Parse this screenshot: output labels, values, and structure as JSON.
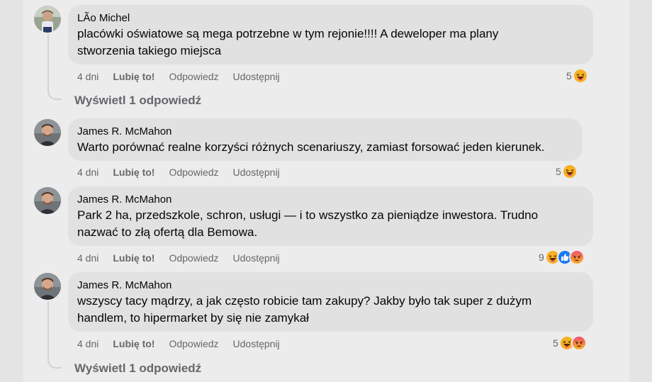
{
  "comments": [
    {
      "author": "LÃo Michel",
      "lines": [
        "placówki oświatowe są mega potrzebne w tym rejonie!!!! A deweloper ma plany",
        "stworzenia takiego miejsca"
      ],
      "time": "4 dni",
      "like": "Lubię to!",
      "reply": "Odpowiedz",
      "share": "Udostępnij",
      "reaction_count": "5",
      "reactions": [
        "haha-icon"
      ],
      "view_replies": "Wyświetl 1 odpowiedź"
    },
    {
      "author": "James R. McMahon",
      "lines": [
        "Warto porównać realne korzyści różnych scenariuszy, zamiast forsować jeden kierunek."
      ],
      "time": "4 dni",
      "like": "Lubię to!",
      "reply": "Odpowiedz",
      "share": "Udostępnij",
      "reaction_count": "5",
      "reactions": [
        "haha-icon"
      ]
    },
    {
      "author": "James R. McMahon",
      "lines": [
        "Park 2 ha, przedszkole, schron, usługi — i to wszystko za pieniądze inwestora. Trudno",
        "nazwać to złą ofertą dla Bemowa."
      ],
      "time": "4 dni",
      "like": "Lubię to!",
      "reply": "Odpowiedz",
      "share": "Udostępnij",
      "reaction_count": "9",
      "reactions": [
        "haha-icon",
        "like-icon",
        "angry-icon"
      ]
    },
    {
      "author": "James R. McMahon",
      "lines": [
        "wszyscy tacy mądrzy, a jak często robicie tam zakupy? Jakby było tak super z dużym",
        "handlem, to hipermarket by się nie zamykał"
      ],
      "time": "4 dni",
      "like": "Lubię to!",
      "reply": "Odpowiedz",
      "share": "Udostępnij",
      "reaction_count": "5",
      "reactions": [
        "haha-icon",
        "angry-icon"
      ],
      "view_replies": "Wyświetl 1 odpowiedź"
    }
  ],
  "colors": {
    "haha": "#f7b125",
    "like": "#1877f2",
    "angry": "#e9710f",
    "bubble": "#e1e1e2",
    "muted": "#65676b"
  }
}
